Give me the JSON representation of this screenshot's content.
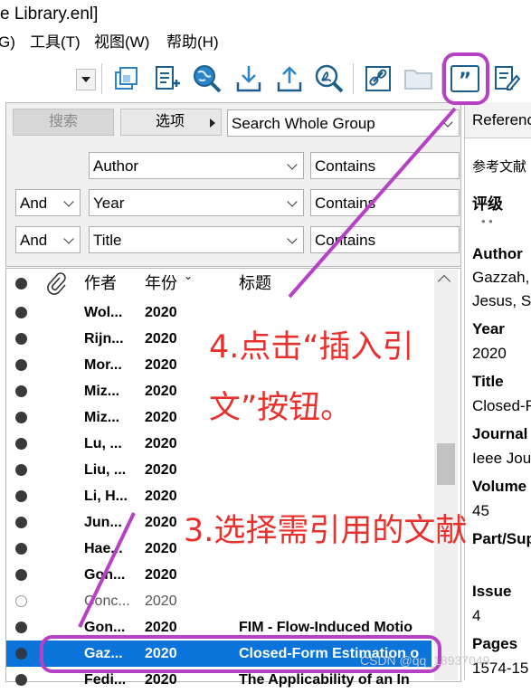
{
  "window": {
    "title": "e  Library.enl]"
  },
  "menu": {
    "items": [
      "G)",
      "工具(T)",
      "视图(W)",
      "帮助(H)"
    ]
  },
  "toolbar": {
    "buttons": [
      "copy-formatted-icon",
      "new-reference-icon",
      "online-search-icon",
      "import-icon",
      "export-icon",
      "find-pdf-icon",
      "open-link-icon",
      "open-file-icon",
      "insert-citation-icon",
      "edit-reference-icon"
    ]
  },
  "search": {
    "search_label": "搜索",
    "options_label": "选项",
    "scope": "Search Whole Group",
    "rows": [
      {
        "bool": "",
        "field": "Author",
        "op": "Contains"
      },
      {
        "bool": "And",
        "field": "Year",
        "op": "Contains"
      },
      {
        "bool": "And",
        "field": "Title",
        "op": "Contains"
      }
    ]
  },
  "list": {
    "headers": {
      "author": "作者",
      "year": "年份",
      "title": "标题"
    },
    "rows": [
      {
        "author": "Wol...",
        "year": "2020",
        "title": "",
        "read": true
      },
      {
        "author": "Rijn...",
        "year": "2020",
        "title": "",
        "read": true
      },
      {
        "author": "Mor...",
        "year": "2020",
        "title": "",
        "read": true
      },
      {
        "author": "Miz...",
        "year": "2020",
        "title": "",
        "read": true
      },
      {
        "author": "Miz...",
        "year": "2020",
        "title": "",
        "read": true
      },
      {
        "author": "Lu, ...",
        "year": "2020",
        "title": "",
        "read": true
      },
      {
        "author": "Liu, ...",
        "year": "2020",
        "title": "",
        "read": true
      },
      {
        "author": "Li, H...",
        "year": "2020",
        "title": "",
        "read": true
      },
      {
        "author": "Jun...",
        "year": "2020",
        "title": "",
        "read": true
      },
      {
        "author": "Hae...",
        "year": "2020",
        "title": "",
        "read": true
      },
      {
        "author": "Gon...",
        "year": "2020",
        "title": "",
        "read": true
      },
      {
        "author": "Conc...",
        "year": "2020",
        "title": "",
        "read": false
      },
      {
        "author": "Gon...",
        "year": "2020",
        "title": "FIM - Flow-Induced Motio",
        "read": true
      },
      {
        "author": "Gaz...",
        "year": "2020",
        "title": "Closed-Form Estimation o",
        "read": true,
        "selected": true
      },
      {
        "author": "Fedi...",
        "year": "2020",
        "title": "The Applicability of an In",
        "read": true
      }
    ]
  },
  "preview": {
    "tab": "Reference",
    "style_label": "参考文献",
    "rating_label": "评级",
    "rating_dots": "•  •",
    "fields": [
      {
        "label": "Author",
        "value": "Gazzah,",
        "value2": "Jesus, S."
      },
      {
        "label": "Year",
        "value": "2020"
      },
      {
        "label": "Title",
        "value": "Closed-F"
      },
      {
        "label": "Journal",
        "value": "Ieee Jour"
      },
      {
        "label": "Volume",
        "value": "45"
      },
      {
        "label": "Part/Sup",
        "value": ""
      },
      {
        "label": "Issue",
        "value": "4"
      },
      {
        "label": "Pages",
        "value": "1574-15"
      }
    ]
  },
  "annotations": {
    "step4_line1": "4.点击“插入引",
    "step4_line2": "文”按钮。",
    "step3": "3.选择需引用的文献",
    "color": "#e8312d",
    "highlight_color": "#b641c4"
  },
  "watermark": "CSDN @qq_18937049"
}
